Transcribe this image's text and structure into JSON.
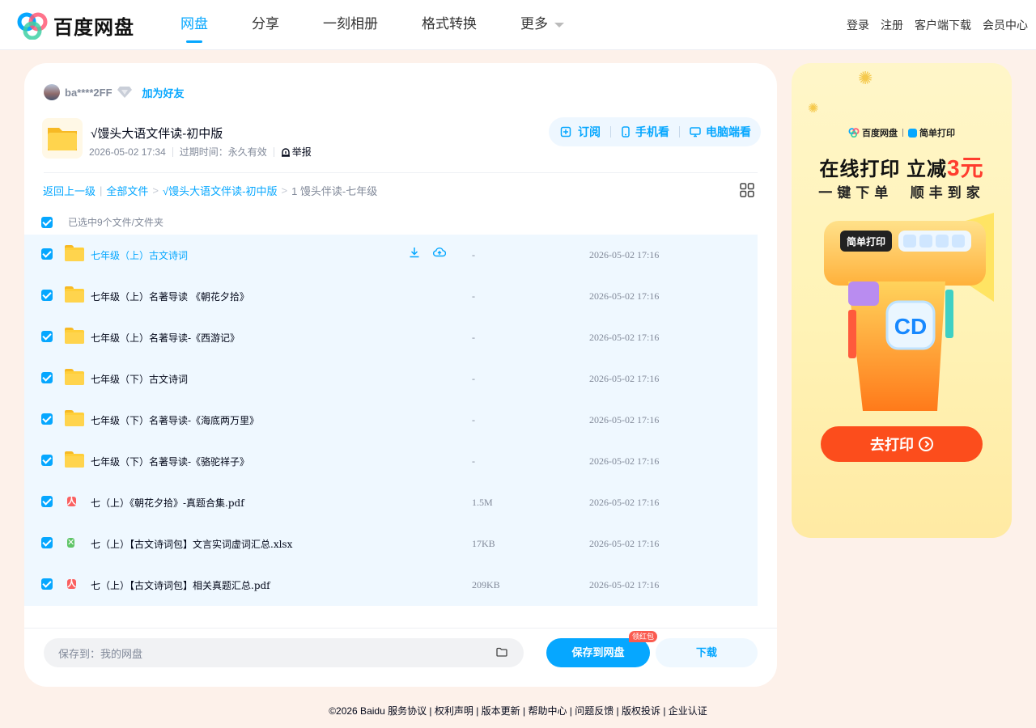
{
  "header": {
    "logo_text": "百度网盘",
    "nav": [
      {
        "label": "网盘",
        "active": true
      },
      {
        "label": "分享",
        "active": false
      },
      {
        "label": "一刻相册",
        "active": false
      },
      {
        "label": "格式转换",
        "active": false
      },
      {
        "label": "更多",
        "active": false
      }
    ],
    "links": [
      "登录",
      "注册",
      "客户端下载",
      "会员中心"
    ]
  },
  "share": {
    "owner": "ba****2FF",
    "add_friend": "加为好友",
    "title": "√馒头大语文伴读-初中版",
    "date": "2026-05-02 17:34",
    "expire_label": "过期时间：",
    "expire_value": "永久有效",
    "report": "举报",
    "actions": {
      "subscribe": "订阅",
      "mobile": "手机看",
      "pc": "电脑端看"
    }
  },
  "breadcrumb": {
    "back": "返回上一级",
    "all": "全部文件",
    "parent": "√馒头大语文伴读-初中版",
    "current": "1 馒头伴读-七年级"
  },
  "selection": {
    "label": "已选中9个文件/文件夹"
  },
  "files": [
    {
      "name": "七年级（上）古文诗词",
      "type": "folder",
      "size": "-",
      "date": "2026-05-02 17:16",
      "hover": true
    },
    {
      "name": "七年级（上）名著导读 《朝花夕拾》",
      "type": "folder",
      "size": "-",
      "date": "2026-05-02 17:16"
    },
    {
      "name": "七年级（上）名著导读-《西游记》",
      "type": "folder",
      "size": "-",
      "date": "2026-05-02 17:16"
    },
    {
      "name": "七年级（下）古文诗词",
      "type": "folder",
      "size": "-",
      "date": "2026-05-02 17:16"
    },
    {
      "name": "七年级（下）名著导读-《海底两万里》",
      "type": "folder",
      "size": "-",
      "date": "2026-05-02 17:16"
    },
    {
      "name": "七年级（下）名著导读-《骆驼祥子》",
      "type": "folder",
      "size": "-",
      "date": "2026-05-02 17:16"
    },
    {
      "name": "七（上）《朝花夕拾》-真题合集.pdf",
      "type": "pdf",
      "size": "1.5M",
      "date": "2026-05-02 17:16"
    },
    {
      "name": "七（上）【古文诗词包】文言实词虚词汇总.xlsx",
      "type": "xlsx",
      "size": "17KB",
      "date": "2026-05-02 17:16"
    },
    {
      "name": "七（上）【古文诗词包】相关真题汇总.pdf",
      "type": "pdf",
      "size": "209KB",
      "date": "2026-05-02 17:16"
    }
  ],
  "bottom": {
    "save_to": "保存到：我的网盘",
    "save_button": "保存到网盘",
    "red_tag": "领红包",
    "download_button": "下载"
  },
  "ad": {
    "brand_a": "百度网盘",
    "brand_b": "简单打印",
    "title_prefix": "在线打印 立减",
    "title_highlight": "3元",
    "subtitle": "一键下单  顺丰到家",
    "art_label": "简单打印",
    "button": "去打印"
  },
  "footer": "©2026 Baidu  服务协议 | 权利声明 | 版本更新 | 帮助中心 | 问题反馈 | 版权投诉 | 企业认证",
  "colors": {
    "accent": "#06a7ff",
    "text": "#03081a",
    "muted": "#818999",
    "row_bg": "#eff8ff",
    "ad_red": "#fc4d1c"
  }
}
